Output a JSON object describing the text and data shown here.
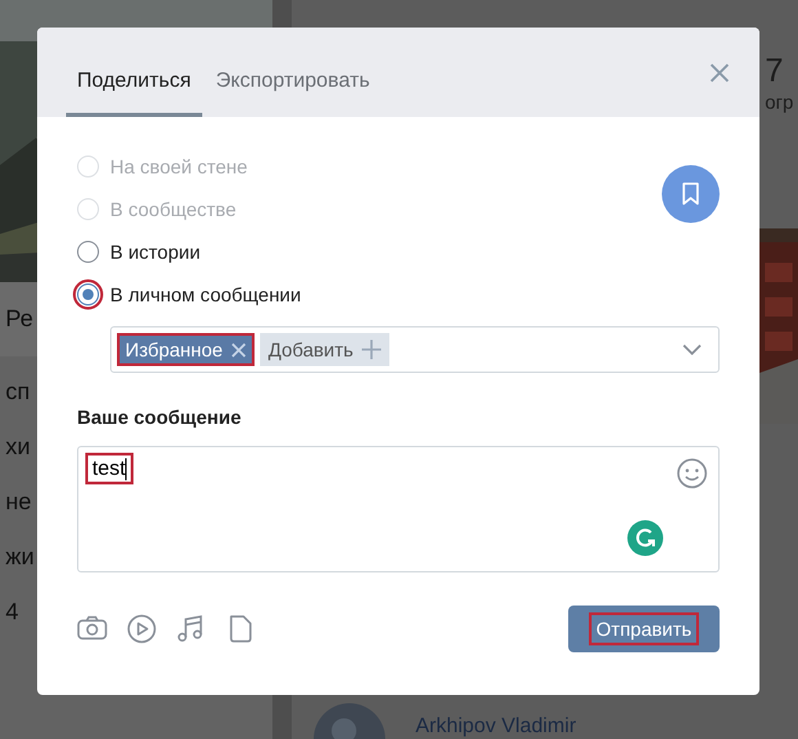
{
  "background": {
    "left_items": [
      "Ре",
      "сп",
      "хи",
      "не",
      "жи",
      "4"
    ],
    "stat": {
      "value": "7",
      "label": "огр"
    },
    "post_author": "Arkhipov Vladimir"
  },
  "dialog": {
    "tabs": [
      {
        "label": "Поделиться",
        "selected": true
      },
      {
        "label": "Экспортировать",
        "selected": false
      }
    ],
    "options": [
      {
        "label": "На своей стене",
        "disabled": true,
        "selected": false,
        "highlighted": false
      },
      {
        "label": "В сообществе",
        "disabled": true,
        "selected": false,
        "highlighted": false
      },
      {
        "label": "В истории",
        "disabled": false,
        "selected": false,
        "highlighted": false
      },
      {
        "label": "В личном сообщении",
        "disabled": false,
        "selected": true,
        "highlighted": true
      }
    ],
    "recipients": [
      {
        "kind": "chip",
        "label": "Избранное",
        "highlighted": true
      },
      {
        "kind": "add",
        "label": "Добавить",
        "highlighted": false
      }
    ],
    "message_label": "Ваше сообщение",
    "message": {
      "value": "test",
      "highlighted": true
    },
    "send_button": {
      "label": "Отправить",
      "highlighted": true
    }
  }
}
